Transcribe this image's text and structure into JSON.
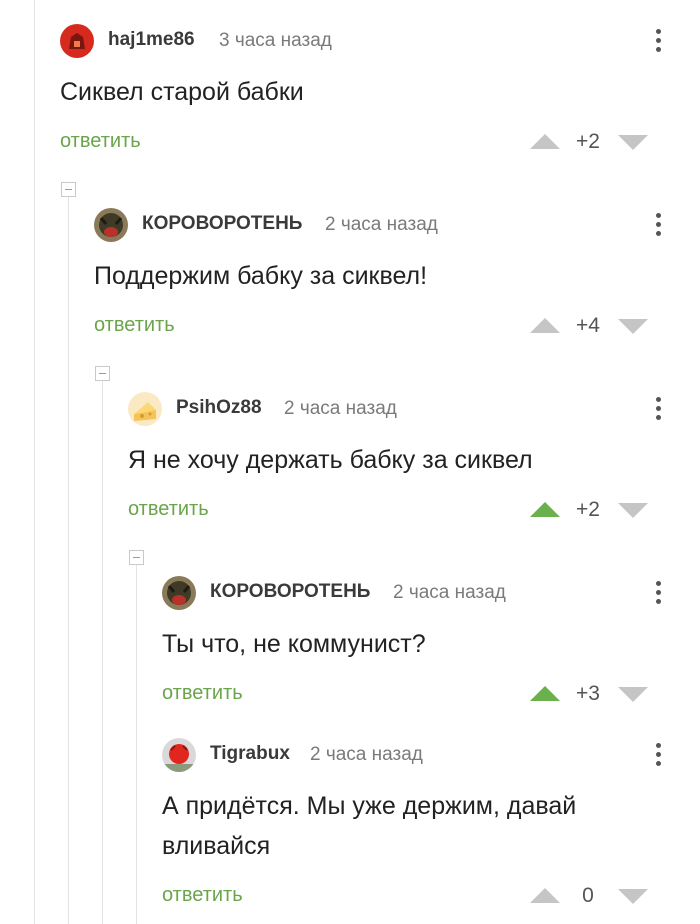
{
  "reply_label": "ответить",
  "comments": [
    {
      "author": "haj1me86",
      "time": "3 часа назад",
      "text": "Сиквел старой бабки",
      "score": "+2",
      "upvoted": false
    },
    {
      "author": "КОРОВОРОТЕНЬ",
      "time": "2 часа назад",
      "text": "Поддержим бабку за сиквел!",
      "score": "+4",
      "upvoted": false
    },
    {
      "author": "PsihOz88",
      "time": "2 часа назад",
      "text": "Я не хочу держать бабку за сиквел",
      "score": "+2",
      "upvoted": true
    },
    {
      "author": "КОРОВОРОТЕНЬ",
      "time": "2 часа назад",
      "text": "Ты что, не коммунист?",
      "score": "+3",
      "upvoted": true
    },
    {
      "author": "Tigrabux",
      "time": "2 часа назад",
      "text": "А придётся. Мы уже держим, давай вливайся",
      "score": "0",
      "upvoted": false
    }
  ],
  "colors": {
    "accent": "#6ab04c",
    "reply": "#6aa54b",
    "vote_inactive": "#c5c5c5"
  }
}
